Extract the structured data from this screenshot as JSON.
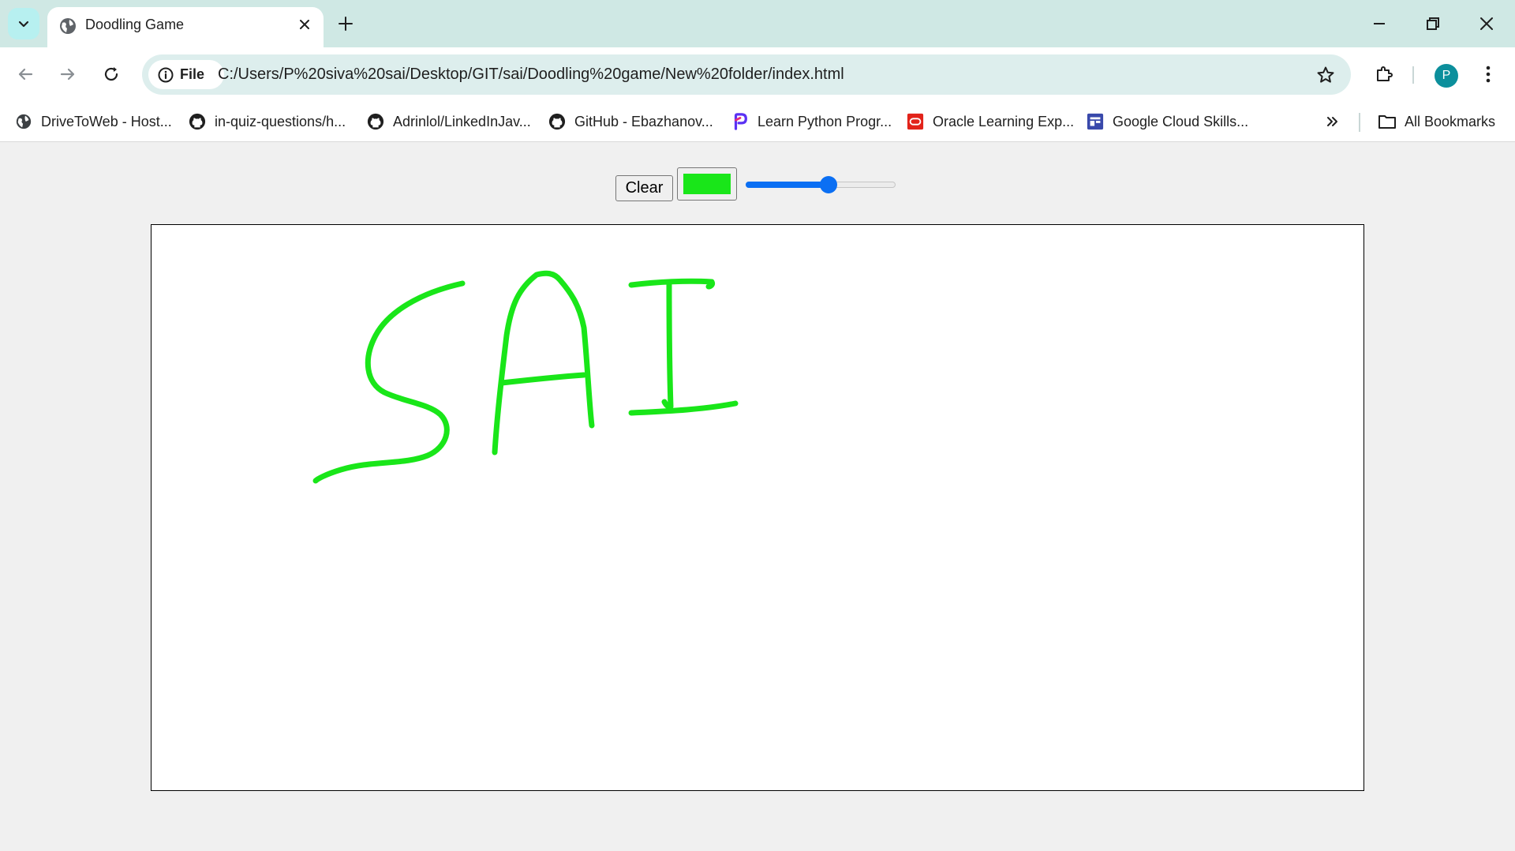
{
  "browser": {
    "tab_title": "Doodling Game",
    "site_chip_label": "File",
    "url": "C:/Users/P%20siva%20sai/Desktop/GIT/sai/Doodling%20game/New%20folder/index.html",
    "profile_initial": "P",
    "bookmarks": [
      {
        "label": "DriveToWeb - Host...",
        "icon": "globe-icon"
      },
      {
        "label": "in-quiz-questions/h...",
        "icon": "github-icon"
      },
      {
        "label": "Adrinlol/LinkedInJav...",
        "icon": "github-icon"
      },
      {
        "label": "GitHub - Ebazhanov...",
        "icon": "github-icon"
      },
      {
        "label": "Learn Python Progr...",
        "icon": "programiz-icon"
      },
      {
        "label": "Oracle Learning Exp...",
        "icon": "oracle-icon"
      },
      {
        "label": "Google Cloud Skills...",
        "icon": "cloud-skills-icon"
      }
    ],
    "all_bookmarks_label": "All Bookmarks"
  },
  "app": {
    "clear_label": "Clear",
    "pen_color": "#19e619",
    "brush_size_fraction": 0.55,
    "drawing_text": "SAI"
  },
  "colors": {
    "chrome_bg": "#cfe8e4",
    "omnibox_bg": "#ddeeed",
    "slider_accent": "#0b6ff3",
    "page_bg": "#f0f0f0"
  }
}
